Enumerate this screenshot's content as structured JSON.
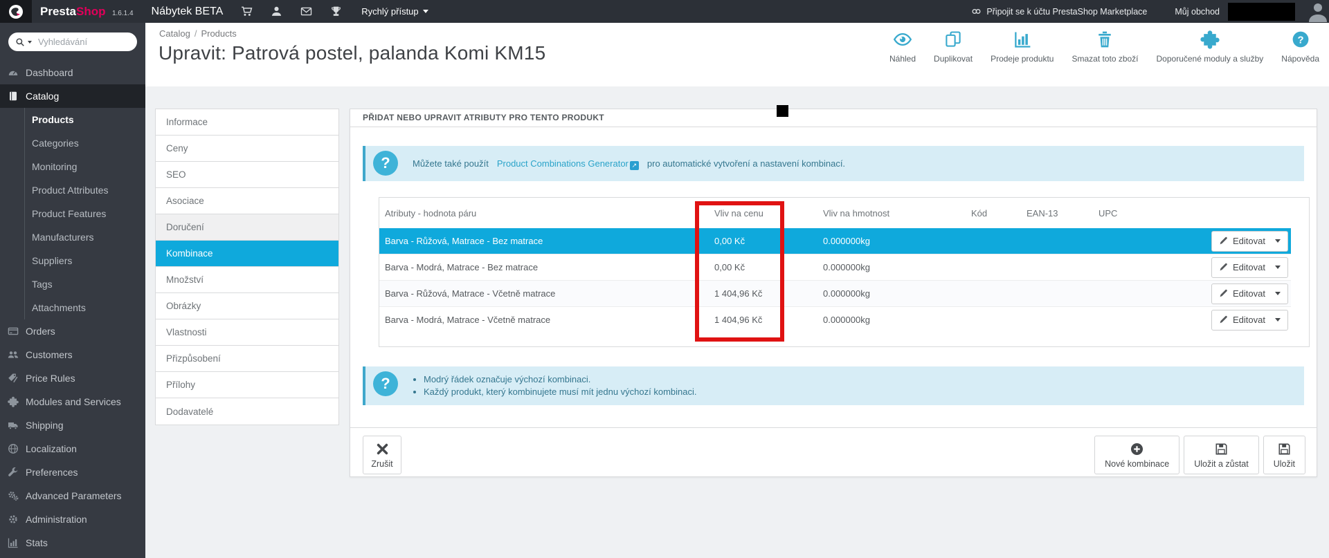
{
  "topbar": {
    "brand_presta": "Presta",
    "brand_shop": "Shop",
    "version": "1.6.1.4",
    "shop_name": "Nábytek BETA",
    "quick_access": "Rychlý přístup",
    "icon_names": [
      "cart-icon",
      "user-icon",
      "mail-icon",
      "trophy-icon"
    ],
    "marketplace_link": "Připojit se k účtu PrestaShop Marketplace",
    "my_shop": "Můj obchod"
  },
  "sidebar": {
    "search_placeholder": "Vyhledávání",
    "items": [
      {
        "label": "Dashboard",
        "icon": "dashboard-icon"
      },
      {
        "label": "Catalog",
        "icon": "catalog-icon",
        "active": true,
        "children": [
          {
            "label": "Products",
            "active": true
          },
          {
            "label": "Categories"
          },
          {
            "label": "Monitoring"
          },
          {
            "label": "Product Attributes"
          },
          {
            "label": "Product Features"
          },
          {
            "label": "Manufacturers"
          },
          {
            "label": "Suppliers"
          },
          {
            "label": "Tags"
          },
          {
            "label": "Attachments"
          }
        ]
      },
      {
        "label": "Orders",
        "icon": "orders-icon"
      },
      {
        "label": "Customers",
        "icon": "customers-icon"
      },
      {
        "label": "Price Rules",
        "icon": "price-rules-icon"
      },
      {
        "label": "Modules and Services",
        "icon": "puzzle-icon"
      },
      {
        "label": "Shipping",
        "icon": "shipping-icon"
      },
      {
        "label": "Localization",
        "icon": "localization-icon"
      },
      {
        "label": "Preferences",
        "icon": "preferences-icon"
      },
      {
        "label": "Advanced Parameters",
        "icon": "advanced-parameters-icon"
      },
      {
        "label": "Administration",
        "icon": "administration-icon"
      },
      {
        "label": "Stats",
        "icon": "stats-icon"
      }
    ]
  },
  "header": {
    "breadcrumb": [
      "Catalog",
      "Products"
    ],
    "title": "Upravit: Patrová postel, palanda Komi KM15",
    "toolbar": [
      {
        "label": "Náhled",
        "icon": "eye-icon"
      },
      {
        "label": "Duplikovat",
        "icon": "duplicate-icon"
      },
      {
        "label": "Prodeje produktu",
        "icon": "product-sales-icon"
      },
      {
        "label": "Smazat toto zboží",
        "icon": "trash-icon"
      },
      {
        "label": "Doporučené moduly a služby",
        "icon": "puzzle-icon"
      },
      {
        "label": "Nápověda",
        "icon": "help-icon"
      }
    ]
  },
  "tabs": [
    {
      "label": "Informace"
    },
    {
      "label": "Ceny"
    },
    {
      "label": "SEO"
    },
    {
      "label": "Asociace"
    },
    {
      "label": "Doručení",
      "hovered": true
    },
    {
      "label": "Kombinace",
      "active": true
    },
    {
      "label": "Množství"
    },
    {
      "label": "Obrázky"
    },
    {
      "label": "Vlastnosti"
    },
    {
      "label": "Přizpůsobení"
    },
    {
      "label": "Přílohy"
    },
    {
      "label": "Dodavatelé"
    }
  ],
  "panel": {
    "heading": "PŘIDAT NEBO UPRAVIT ATRIBUTY PRO TENTO PRODUKT",
    "info_top": {
      "prefix": "Můžete také použít",
      "link": "Product Combinations Generator",
      "suffix": "pro automatické vytvoření a nastavení kombinací."
    },
    "table": {
      "columns": [
        "Atributy - hodnota páru",
        "Vliv na cenu",
        "Vliv na hmotnost",
        "Kód",
        "EAN-13",
        "UPC"
      ],
      "edit_button": "Editovat",
      "rows": [
        {
          "attributes": "Barva - Růžová, Matrace - Bez matrace",
          "price_impact": "0,00 Kč",
          "weight_impact": "0.000000kg",
          "code": "",
          "ean13": "",
          "upc": "",
          "selected": true
        },
        {
          "attributes": "Barva - Modrá, Matrace - Bez matrace",
          "price_impact": "0,00 Kč",
          "weight_impact": "0.000000kg",
          "code": "",
          "ean13": "",
          "upc": "",
          "selected": false
        },
        {
          "attributes": "Barva - Růžová, Matrace - Včetně matrace",
          "price_impact": "1 404,96 Kč",
          "weight_impact": "0.000000kg",
          "code": "",
          "ean13": "",
          "upc": "",
          "selected": false
        },
        {
          "attributes": "Barva - Modrá, Matrace - Včetně matrace",
          "price_impact": "1 404,96 Kč",
          "weight_impact": "0.000000kg",
          "code": "",
          "ean13": "",
          "upc": "",
          "selected": false
        }
      ]
    },
    "info_bottom": [
      "Modrý řádek označuje výchozí kombinaci.",
      "Každý produkt, který kombinujete musí mít jednu výchozí kombinaci."
    ],
    "footer": {
      "cancel": "Zrušit",
      "new_combination": "Nové kombinace",
      "save_and_stay": "Uložit a zůstat",
      "save": "Uložit"
    }
  },
  "annotations": {
    "red_highlight_box": {
      "color": "#e01212",
      "around": "Vliv na cenu column"
    },
    "black_marker": {
      "color": "#000000"
    }
  },
  "colors": {
    "accent": "#0fa9dc",
    "topbar_bg": "#2c3037",
    "sidebar_bg": "#363a42",
    "brand_pink": "#e0005a",
    "info_bg": "#d7edf6",
    "info_text": "#35778f",
    "link": "#2aa3c9",
    "toolbar_icon": "#38a9cd"
  }
}
